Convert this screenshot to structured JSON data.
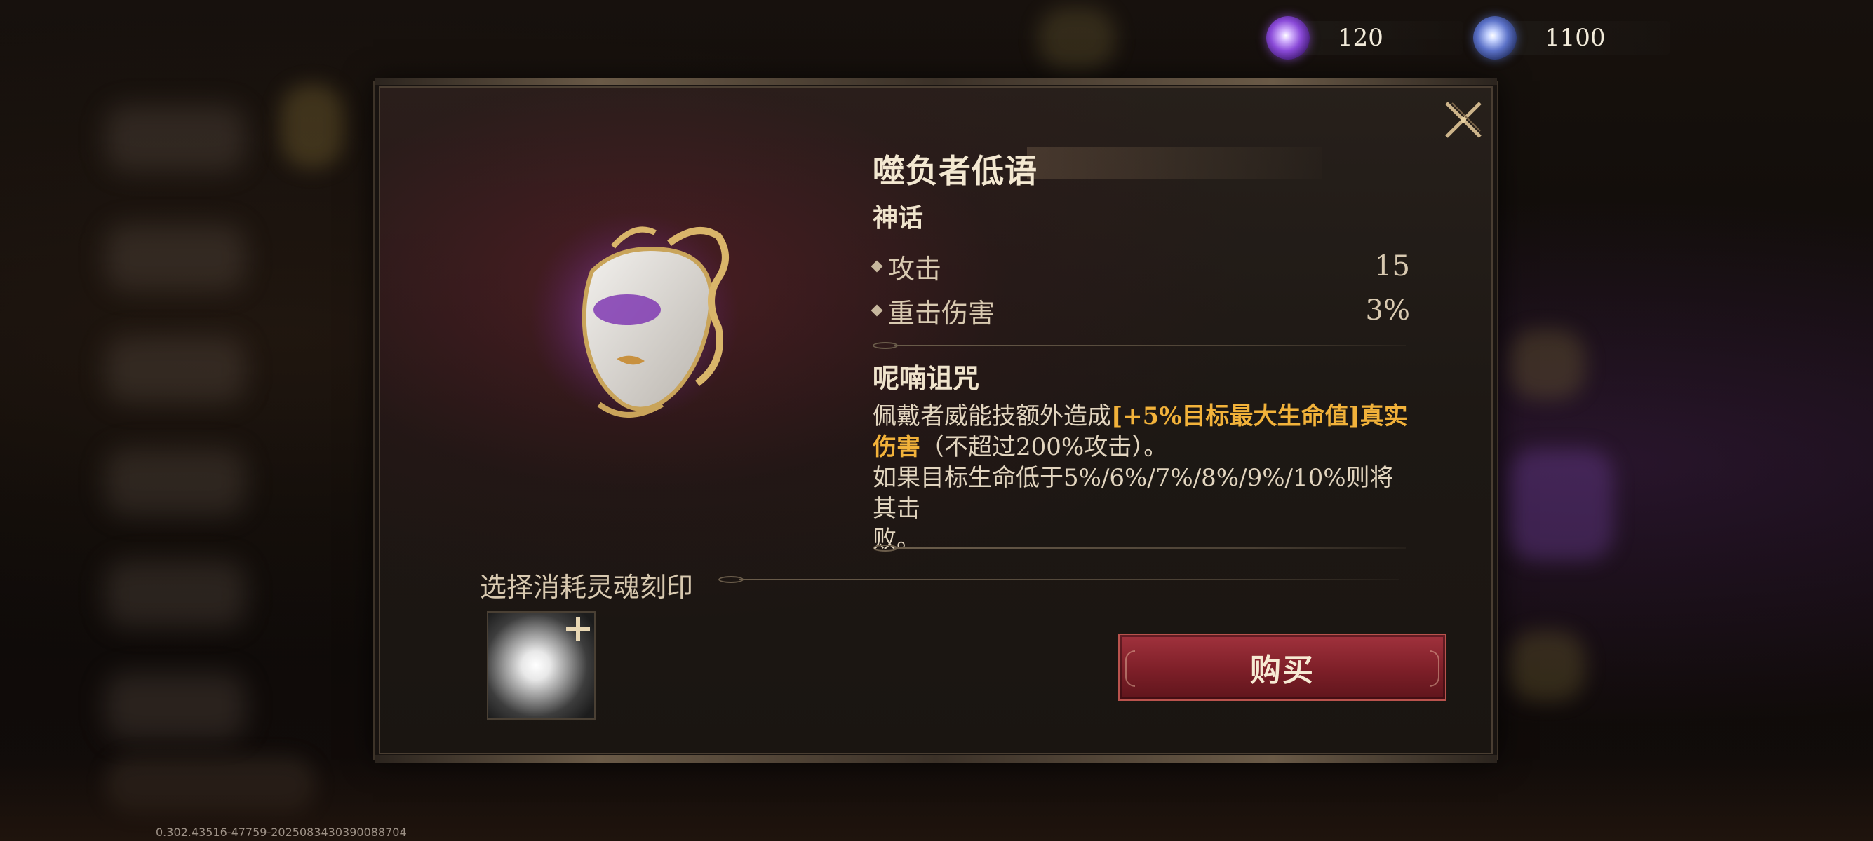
{
  "currency": [
    {
      "icon": "purple-soul-orb-icon",
      "value": "120"
    },
    {
      "icon": "blue-soul-orb-icon",
      "value": "1100"
    }
  ],
  "item": {
    "name": "噬负者低语",
    "rarity": "神话",
    "stats": [
      {
        "label": "攻击",
        "value": "15"
      },
      {
        "label": "重击伤害",
        "value": "3%"
      }
    ],
    "skill_name": "呢喃诅咒",
    "desc_line1_prefix": "佩戴者威能技额外造成",
    "desc_highlight1": "[+5%目标最大生命值]真实",
    "desc_highlight2": "伤害",
    "desc_line2_suffix": "（不超过200%攻击）。",
    "desc_line3": "如果目标生命低于5%/6%/7%/8%/9%/10%则将其击",
    "desc_line4": "败。"
  },
  "consume_label": "选择消耗灵魂刻印",
  "buy_label": "购买",
  "build_version": "0.302.43516-47759-2025083430390088704",
  "colors": {
    "highlight": "#f2b23a",
    "buy_button": "#8a2630"
  }
}
